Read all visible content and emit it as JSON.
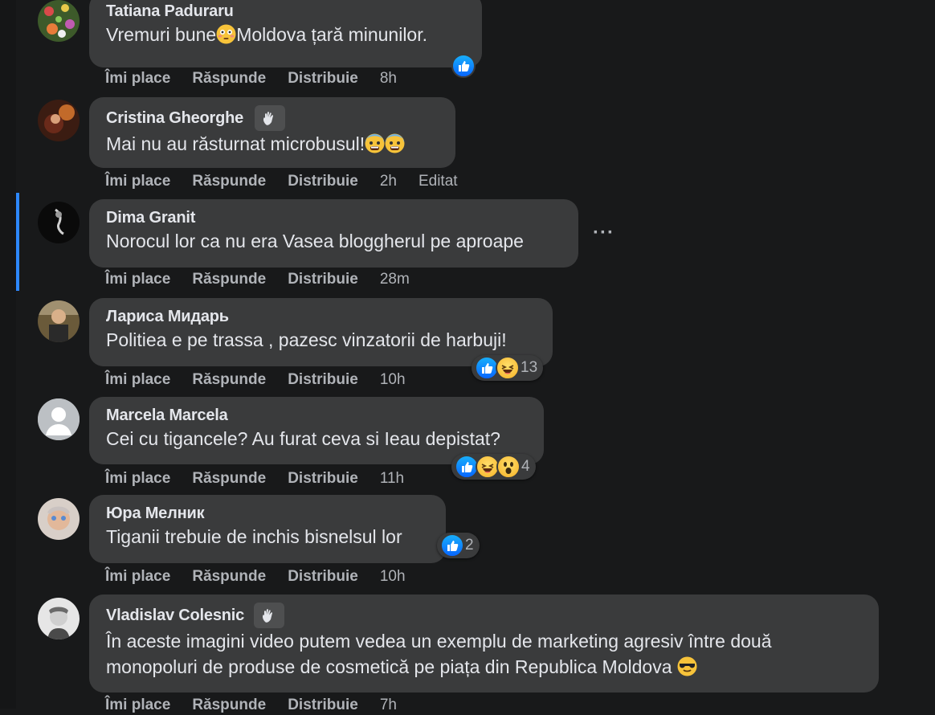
{
  "comments": [
    {
      "author": "Tatiana Paduraru",
      "text_a": "Vremuri bune",
      "text_b": "Moldova țară minunilor.",
      "inline_emoji": "flushed-face-icon",
      "time": "8h",
      "reactions": {
        "types": [
          "like"
        ],
        "count": ""
      }
    },
    {
      "author": "Cristina Gheorghe",
      "badge": "wave-icon",
      "text": "Mai nu au răsturnat microbusul!",
      "inline_emoji": "fearful-face-icon",
      "time": "2h",
      "edited": "Editat"
    },
    {
      "author": "Dima Granit",
      "text": "Norocul lor ca nu era Vasea bloggherul pe aproape",
      "time": "28m",
      "more": "···"
    },
    {
      "author": "Лариса Мидарь",
      "text": "Politiea e pe trassa , pazesc vinzatorii de harbuji!",
      "time": "10h",
      "reactions": {
        "types": [
          "like",
          "haha"
        ],
        "count": "13"
      }
    },
    {
      "author": "Marcela Marcela",
      "text": "Cei cu tigancele? Au furat ceva si Ieau depistat?",
      "time": "11h",
      "reactions": {
        "types": [
          "like",
          "haha",
          "wow"
        ],
        "count": "4"
      }
    },
    {
      "author": "Юра Мелник",
      "text": "Tiganii trebuie de inchis bisnelsul lor",
      "time": "10h",
      "reactions": {
        "types": [
          "like"
        ],
        "count": "2"
      }
    },
    {
      "author": "Vladislav Colesnic",
      "badge": "wave-icon",
      "text_line1": "În aceste imagini video putem vedea un exemplu de marketing agresiv între două",
      "text_line2": "monopoluri de produse de cosmetică pe piața din Republica Moldova",
      "inline_emoji": "sunglasses-face-icon",
      "time": "7h"
    }
  ],
  "actions": {
    "like": "Îmi place",
    "reply": "Răspunde",
    "share": "Distribuie"
  },
  "colors": {
    "background": "#18191a",
    "bubble": "#3a3b3c",
    "text": "#e4e6eb",
    "muted": "#b0b3b8",
    "accent": "#2d88ff"
  }
}
